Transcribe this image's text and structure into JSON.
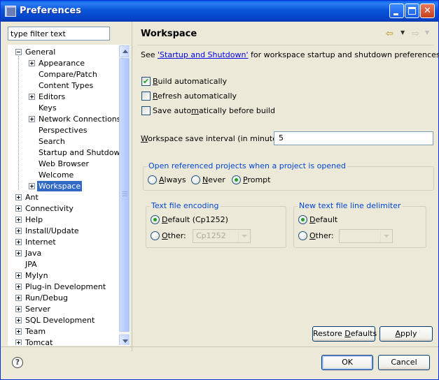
{
  "window": {
    "title": "Preferences",
    "minimize_icon": "minimize-icon",
    "maximize_icon": "maximize-icon",
    "close_glyph": "✕"
  },
  "filter": {
    "placeholder": "type filter text"
  },
  "tree": {
    "items": [
      {
        "label": "General",
        "level": 0,
        "expander": "minus"
      },
      {
        "label": "Appearance",
        "level": 1,
        "expander": "plus"
      },
      {
        "label": "Compare/Patch",
        "level": 1,
        "expander": "none"
      },
      {
        "label": "Content Types",
        "level": 1,
        "expander": "none"
      },
      {
        "label": "Editors",
        "level": 1,
        "expander": "plus"
      },
      {
        "label": "Keys",
        "level": 1,
        "expander": "none"
      },
      {
        "label": "Network Connections",
        "level": 1,
        "expander": "plus"
      },
      {
        "label": "Perspectives",
        "level": 1,
        "expander": "none"
      },
      {
        "label": "Search",
        "level": 1,
        "expander": "none"
      },
      {
        "label": "Startup and Shutdown",
        "level": 1,
        "expander": "none"
      },
      {
        "label": "Web Browser",
        "level": 1,
        "expander": "none"
      },
      {
        "label": "Welcome",
        "level": 1,
        "expander": "none"
      },
      {
        "label": "Workspace",
        "level": 1,
        "expander": "plus",
        "selected": true
      },
      {
        "label": "Ant",
        "level": 0,
        "expander": "plus"
      },
      {
        "label": "Connectivity",
        "level": 0,
        "expander": "plus"
      },
      {
        "label": "Help",
        "level": 0,
        "expander": "plus"
      },
      {
        "label": "Install/Update",
        "level": 0,
        "expander": "plus"
      },
      {
        "label": "Internet",
        "level": 0,
        "expander": "plus"
      },
      {
        "label": "Java",
        "level": 0,
        "expander": "plus"
      },
      {
        "label": "JPA",
        "level": 0,
        "expander": "none"
      },
      {
        "label": "Mylyn",
        "level": 0,
        "expander": "plus"
      },
      {
        "label": "Plug-in Development",
        "level": 0,
        "expander": "plus"
      },
      {
        "label": "Run/Debug",
        "level": 0,
        "expander": "plus"
      },
      {
        "label": "Server",
        "level": 0,
        "expander": "plus"
      },
      {
        "label": "SQL Development",
        "level": 0,
        "expander": "plus"
      },
      {
        "label": "Team",
        "level": 0,
        "expander": "plus"
      },
      {
        "label": "Tomcat",
        "level": 0,
        "expander": "plus"
      }
    ]
  },
  "page": {
    "title": "Workspace",
    "back_icon": "back-arrow-icon",
    "forward_icon": "forward-arrow-icon",
    "see_prefix": "See ",
    "see_link": "'Startup and Shutdown'",
    "see_suffix": " for workspace startup and shutdown preferences.",
    "build_auto": {
      "pre": "",
      "mnemonic": "B",
      "post": "uild automatically",
      "checked": true
    },
    "refresh_auto": {
      "pre": "",
      "mnemonic": "R",
      "post": "efresh automatically",
      "checked": false
    },
    "save_auto": {
      "pre": "Save auto",
      "mnemonic": "m",
      "post": "atically before build",
      "checked": false
    },
    "interval": {
      "pre": "",
      "mnemonic": "W",
      "post": "orkspace save interval (in minutes):",
      "value": "5"
    },
    "open_projects": {
      "legend": "Open referenced projects when a project is opened",
      "always": {
        "mnemonic": "A",
        "post": "lways"
      },
      "never": {
        "mnemonic": "N",
        "post": "ever"
      },
      "prompt": {
        "mnemonic": "P",
        "post": "rompt"
      },
      "selected": "prompt"
    },
    "encoding": {
      "legend": "Text file encoding",
      "default": {
        "mnemonic": "D",
        "post": "efault (Cp1252)"
      },
      "other": {
        "mnemonic": "O",
        "post": "ther:"
      },
      "other_value": "Cp1252",
      "selected": "default"
    },
    "delimiter": {
      "legend": "New text file line delimiter",
      "default": {
        "mnemonic": "D",
        "post": "efault"
      },
      "other": {
        "mnemonic": "O",
        "post": "ther:"
      },
      "other_value": "",
      "selected": "default"
    },
    "restore_defaults": {
      "pre": "Restore ",
      "mnemonic": "D",
      "post": "efaults"
    },
    "apply": {
      "pre": "",
      "mnemonic": "A",
      "post": "pply"
    }
  },
  "footer": {
    "help_glyph": "?",
    "ok_label": "OK",
    "cancel_label": "Cancel"
  },
  "colors": {
    "titlebar": "#0a55d8",
    "selection": "#316ac5",
    "link": "#0000ee",
    "group_legend": "#0046d5",
    "check_mark": "#21a121"
  }
}
